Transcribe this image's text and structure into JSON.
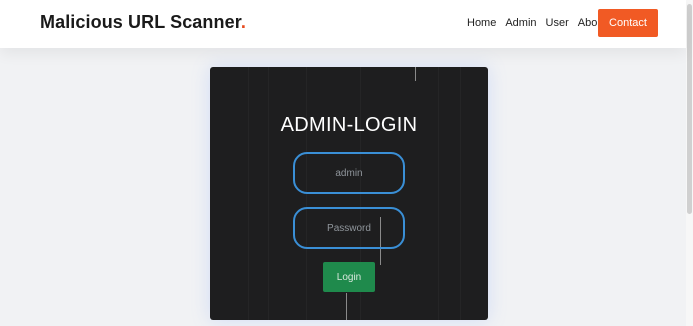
{
  "header": {
    "brand": "Malicious URL Scanner",
    "brand_dot": ".",
    "nav": [
      {
        "label": "Home"
      },
      {
        "label": "Admin"
      },
      {
        "label": "User"
      },
      {
        "label": "About"
      }
    ],
    "contact_label": "Contact"
  },
  "login": {
    "title": "ADMIN-LOGIN",
    "username_value": "",
    "username_placeholder": "admin",
    "password_value": "",
    "password_placeholder": "Password",
    "submit_label": "Login"
  },
  "colors": {
    "accent": "#f15a24",
    "card_background": "#1e1e1f",
    "field_border": "#3a8fd6",
    "login_button": "#1f8a4c"
  }
}
